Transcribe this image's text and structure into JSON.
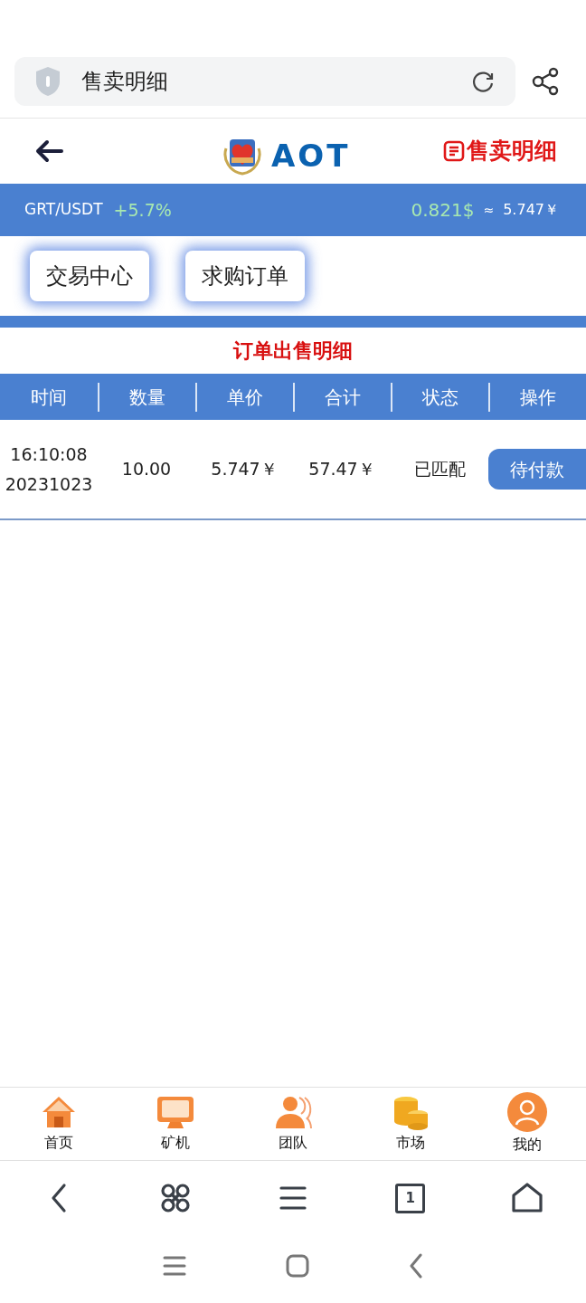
{
  "address_bar": {
    "title": "售卖明细"
  },
  "header": {
    "brand": "AOT",
    "page_link": "售卖明细"
  },
  "ticker": {
    "pair": "GRT/USDT",
    "change": "+5.7%",
    "price_usd": "0.821$",
    "approx": "≈",
    "price_cny": "5.747￥"
  },
  "actions": [
    "交易中心",
    "求购订单"
  ],
  "section_title": "订单出售明细",
  "table": {
    "columns": [
      "时间",
      "数量",
      "单价",
      "合计",
      "状态",
      "操作"
    ],
    "rows": [
      {
        "time": "16:10:08",
        "date": "20231023",
        "quantity": "10.00",
        "unit_price": "5.747￥",
        "total": "57.47￥",
        "status": "已匹配",
        "action": "待付款"
      }
    ]
  },
  "bottom_nav": [
    {
      "kind": "home",
      "label": "首页"
    },
    {
      "kind": "monitor",
      "label": "矿机"
    },
    {
      "kind": "team",
      "label": "团队"
    },
    {
      "kind": "coins",
      "label": "市场"
    },
    {
      "kind": "user",
      "label": "我的"
    }
  ],
  "browser_toolbar": {
    "tab_count": "1"
  }
}
